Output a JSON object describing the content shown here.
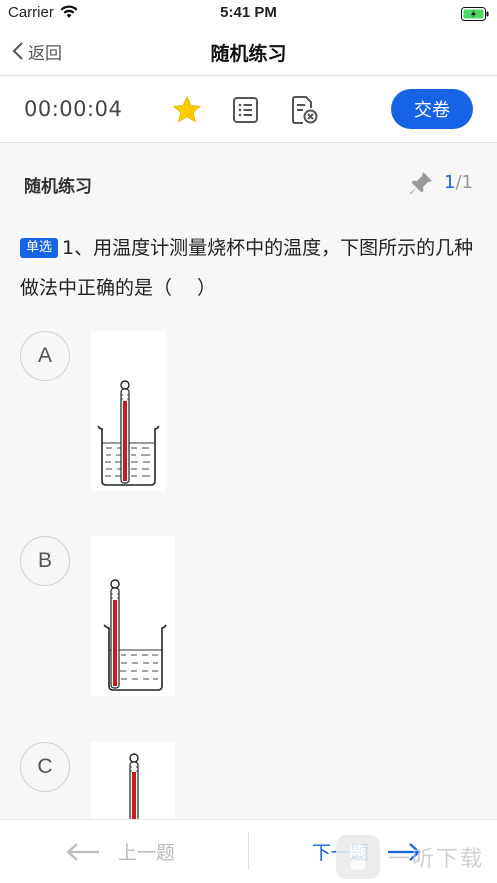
{
  "status_bar": {
    "carrier": "Carrier",
    "time": "5:41 PM"
  },
  "nav": {
    "back_label": "返回",
    "title": "随机练习"
  },
  "toolbar": {
    "timer": "00:00:04",
    "submit_label": "交卷",
    "icons": [
      "star-icon",
      "list-icon",
      "answer-sheet-icon"
    ]
  },
  "section": {
    "title": "随机练习",
    "current": "1",
    "separator": "/",
    "total": "1"
  },
  "question": {
    "type_badge": "单选",
    "text": "1、用温度计测量烧杯中的温度，下图所示的几种做法中正确的是（　 ）"
  },
  "options": [
    {
      "label": "A"
    },
    {
      "label": "B"
    },
    {
      "label": "C"
    }
  ],
  "bottom": {
    "prev_label": "上一题",
    "next_label": "下一题"
  },
  "watermark": {
    "text": "一听下载"
  },
  "colors": {
    "accent": "#1763e6",
    "star": "#ffcc00",
    "thermometer": "#cc1a1a"
  }
}
